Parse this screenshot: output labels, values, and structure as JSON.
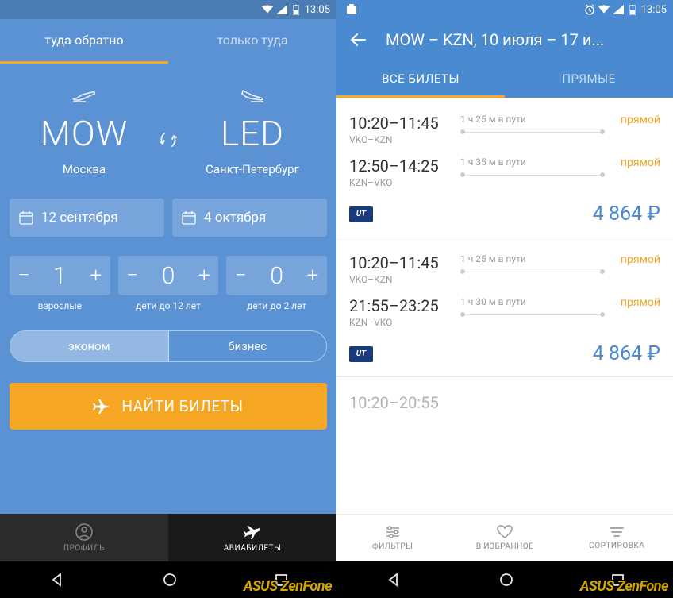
{
  "status": {
    "time": "13:05"
  },
  "left": {
    "trip_tabs": {
      "roundtrip": "туда-обратно",
      "oneway": "только туда"
    },
    "route": {
      "from_code": "MOW",
      "from_city": "Москва",
      "to_code": "LED",
      "to_city": "Санкт-Петербург"
    },
    "dates": {
      "depart": "12 сентября",
      "return": "4 октября"
    },
    "pax": {
      "adults": {
        "value": "1",
        "label": "взрослые"
      },
      "children": {
        "value": "0",
        "label": "дети до 12 лет"
      },
      "infants": {
        "value": "0",
        "label": "дети до 2 лет"
      }
    },
    "cabin": {
      "economy": "эконом",
      "business": "бизнес"
    },
    "search_btn": "НАЙТИ БИЛЕТЫ",
    "bottomnav": {
      "profile": "ПРОФИЛЬ",
      "flights": "АВИАБИЛЕТЫ"
    }
  },
  "right": {
    "title": "MOW – KZN, 10 июля – 17 и...",
    "tabs": {
      "all": "ВСЕ БИЛЕТЫ",
      "direct": "ПРЯМЫЕ"
    },
    "results": [
      {
        "legs": [
          {
            "time": "10:20–11:45",
            "route": "VKO–KZN",
            "duration": "1 ч 25 м в пути",
            "tag": "прямой"
          },
          {
            "time": "12:50–14:25",
            "route": "KZN–VKO",
            "duration": "1 ч 35 м в пути",
            "tag": "прямой"
          }
        ],
        "airline": "UT",
        "price": "4 864 ₽"
      },
      {
        "legs": [
          {
            "time": "10:20–11:45",
            "route": "VKO–KZN",
            "duration": "1 ч 25 м в пути",
            "tag": "прямой"
          },
          {
            "time": "21:55–23:25",
            "route": "KZN–VKO",
            "duration": "1 ч 30 м в пути",
            "tag": "прямой"
          }
        ],
        "airline": "UT",
        "price": "4 864 ₽"
      }
    ],
    "partial_time": "10:20–20:55",
    "bottomnav": {
      "filters": "ФИЛЬТРЫ",
      "favorites": "В ИЗБРАННОЕ",
      "sort": "СОРТИРОВКА"
    }
  },
  "watermark": "ASUS ZenFone"
}
